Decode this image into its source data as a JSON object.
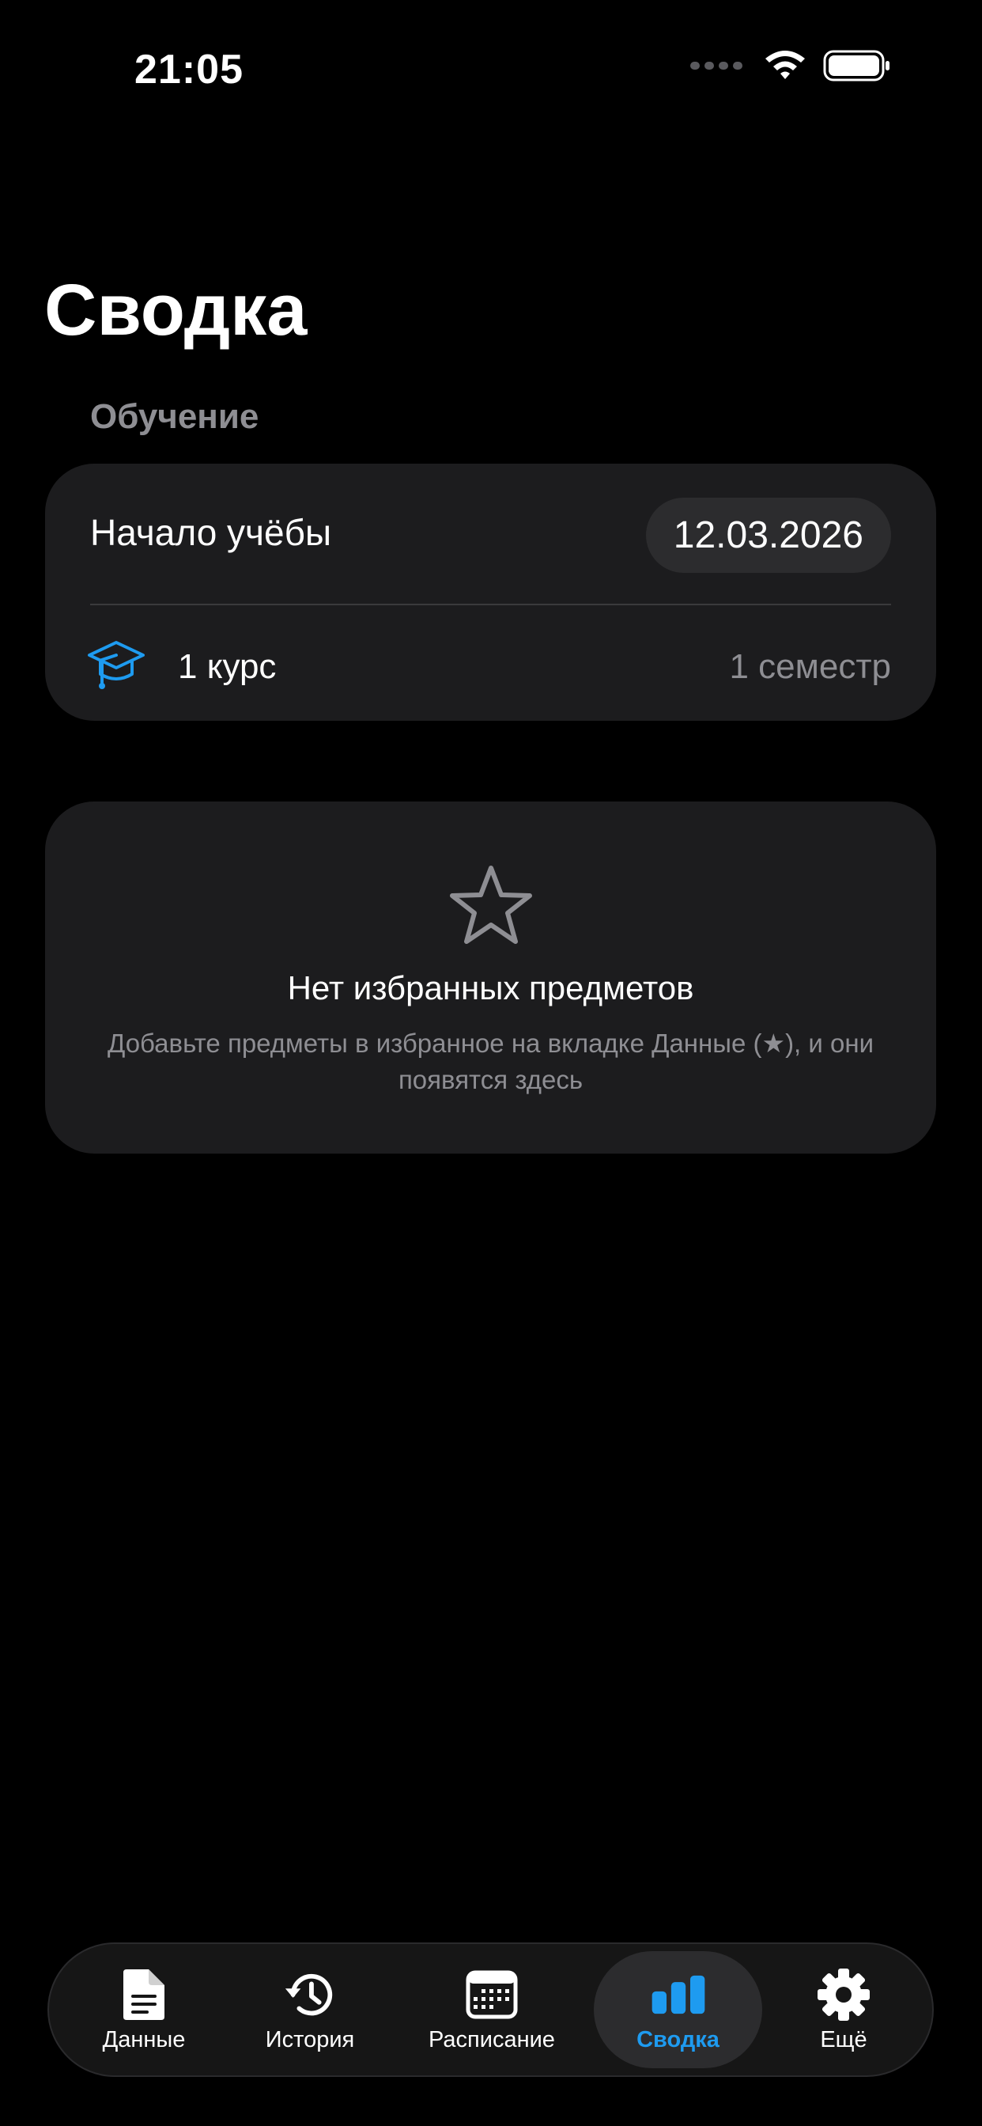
{
  "status_bar": {
    "time": "21:05"
  },
  "page": {
    "title": "Сводка"
  },
  "study_section": {
    "header": "Обучение",
    "start_label": "Начало учёбы",
    "start_date": "12.03.2026",
    "course": "1 курс",
    "semester": "1 семестр"
  },
  "favorites": {
    "empty_title": "Нет избранных предметов",
    "empty_description": "Добавьте предметы в избранное на вкладке Данные (★), и они появятся здесь"
  },
  "tab_bar": {
    "tabs": [
      {
        "label": "Данные",
        "icon": "document-icon",
        "active": false
      },
      {
        "label": "История",
        "icon": "history-icon",
        "active": false
      },
      {
        "label": "Расписание",
        "icon": "calendar-icon",
        "active": false
      },
      {
        "label": "Сводка",
        "icon": "bar-chart-icon",
        "active": true
      },
      {
        "label": "Ещё",
        "icon": "gear-icon",
        "active": false
      }
    ]
  },
  "colors": {
    "accent": "#1e9bf0",
    "background": "#000000",
    "card": "#1c1c1e",
    "secondary_text": "#8e8e93"
  }
}
